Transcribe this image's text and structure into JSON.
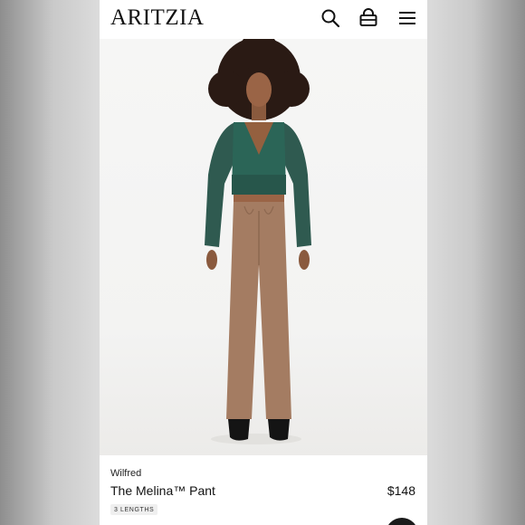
{
  "header": {
    "logo": "ARITZIA",
    "icons": [
      "search-icon",
      "bag-icon",
      "menu-icon"
    ]
  },
  "hero": {
    "image": "model-photo"
  },
  "product": {
    "brand": "Wilfred",
    "name": "The Melina™ Pant",
    "price": "$148",
    "badge": "3 LENGTHS"
  },
  "colors": {
    "background": "#ffffff",
    "text": "#111111",
    "badge_bg": "#efefef"
  }
}
